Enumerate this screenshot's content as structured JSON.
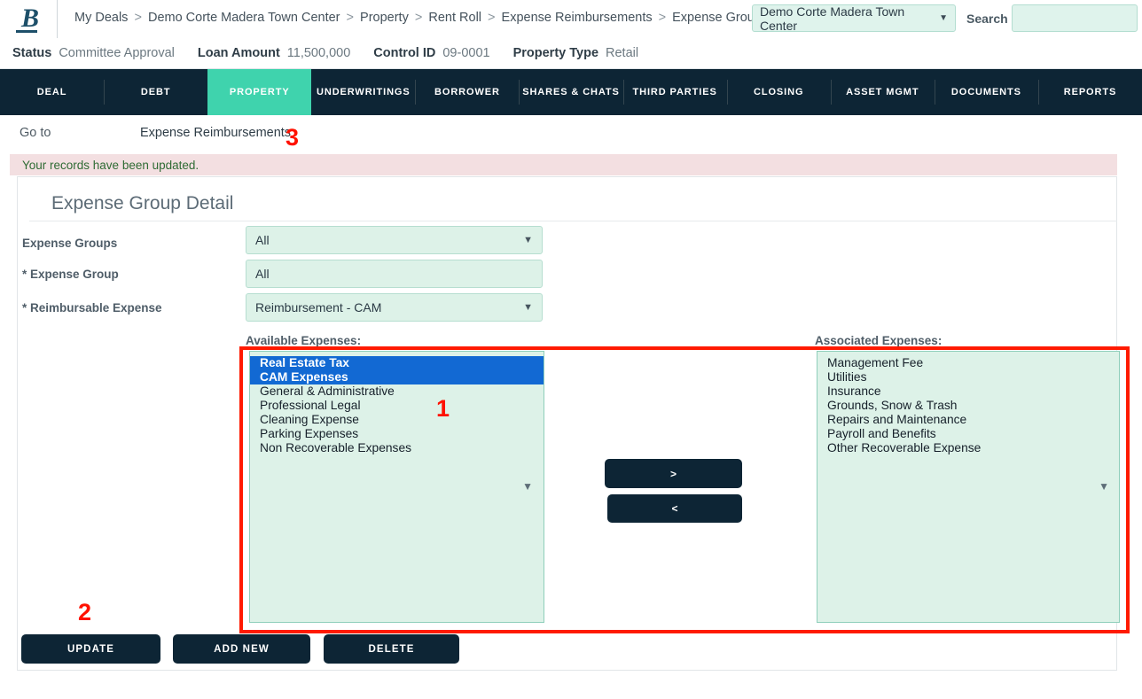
{
  "topbar": {
    "logo_text": "B",
    "logo_icon": "letter-b-logo",
    "breadcrumb": [
      "My Deals",
      "Demo Corte Madera Town Center",
      "Property",
      "Rent Roll",
      "Expense Reimbursements",
      "Expense Groups"
    ],
    "breadcrumb_separator": ">",
    "deal_selector": {
      "value": "Demo Corte Madera Town Center",
      "caret_icon": "chevron-down-icon"
    },
    "search": {
      "label": "Search",
      "value": "",
      "placeholder": ""
    }
  },
  "status_strip": [
    {
      "key": "Status",
      "value": "Committee Approval"
    },
    {
      "key": "Loan Amount",
      "value": "11,500,000"
    },
    {
      "key": "Control ID",
      "value": "09-0001"
    },
    {
      "key": "Property Type",
      "value": "Retail"
    }
  ],
  "nav": {
    "active": "PROPERTY",
    "items": [
      "DEAL",
      "DEBT",
      "PROPERTY",
      "UNDERWRITINGS",
      "BORROWER",
      "SHARES & CHATS",
      "THIRD PARTIES",
      "CLOSING",
      "ASSET MGMT",
      "DOCUMENTS",
      "REPORTS"
    ]
  },
  "goto": {
    "label": "Go to",
    "value": "Expense Reimbursements"
  },
  "alert": {
    "message": "Your records have been updated."
  },
  "card": {
    "title": "Expense Group Detail",
    "fields": [
      {
        "label": "Expense Groups",
        "value": "All",
        "type": "select"
      },
      {
        "label": "* Expense Group",
        "value": "All",
        "type": "text"
      },
      {
        "label": "* Reimbursable Expense",
        "value": "Reimbursement - CAM",
        "type": "select"
      }
    ],
    "available": {
      "caption": "Available Expenses:",
      "items": [
        {
          "label": "Real Estate Tax",
          "selected": true
        },
        {
          "label": "CAM Expenses",
          "selected": true
        },
        {
          "label": "General & Administrative",
          "selected": false
        },
        {
          "label": "Professional Legal",
          "selected": false
        },
        {
          "label": "Cleaning Expense",
          "selected": false
        },
        {
          "label": "Parking Expenses",
          "selected": false
        },
        {
          "label": "Non Recoverable Expenses",
          "selected": false
        }
      ]
    },
    "associated": {
      "caption": "Associated Expenses:",
      "items": [
        {
          "label": "Management Fee",
          "selected": false
        },
        {
          "label": "Utilities",
          "selected": false
        },
        {
          "label": "Insurance",
          "selected": false
        },
        {
          "label": "Grounds, Snow & Trash",
          "selected": false
        },
        {
          "label": "Repairs and Maintenance",
          "selected": false
        },
        {
          "label": "Payroll and Benefits",
          "selected": false
        },
        {
          "label": "Other Recoverable Expense",
          "selected": false
        }
      ]
    },
    "transfer": {
      "move_right": ">",
      "move_left": "<"
    },
    "actions": {
      "update": "UPDATE",
      "add_new": "ADD NEW",
      "delete": "DELETE"
    }
  },
  "annotations": {
    "one": "1",
    "two": "2",
    "three": "3"
  },
  "colors": {
    "nav_bg": "#0d2535",
    "nav_active": "#3fd3ad",
    "field_bg": "#ddf2e8",
    "field_border": "#b6ded0",
    "alert_bg": "#f3dfe1",
    "alert_text": "#2f6b34",
    "selection_blue": "#1269d3",
    "annotation_red": "#ff1a00",
    "logo_blue": "#1d4f69"
  }
}
